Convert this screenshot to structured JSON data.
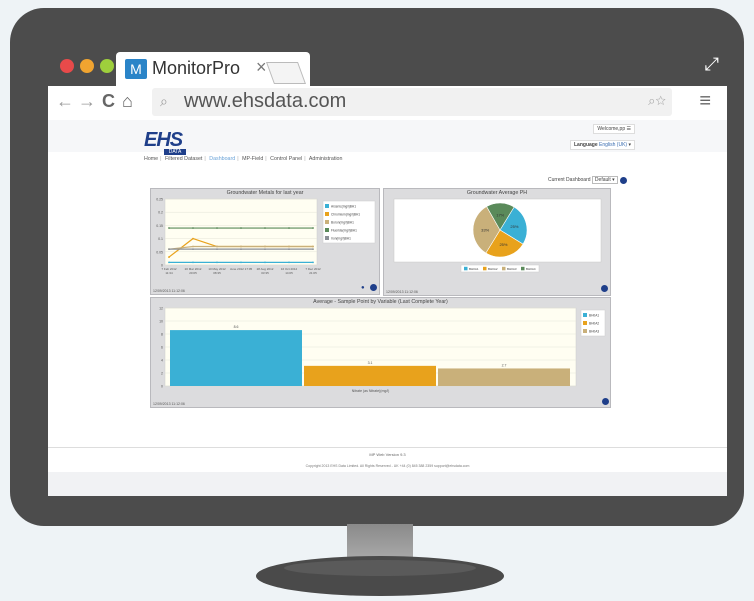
{
  "browser": {
    "tab_title": "MonitorPro",
    "tab_close": "×",
    "url": "www.ehsdata.com"
  },
  "site": {
    "logo": "EHS",
    "logo_sub": "DATA",
    "welcome": "Welcome,pp",
    "language_label": "Language",
    "language_value": "English (UK)"
  },
  "breadcrumb": [
    "Home",
    "Filtered Dataset",
    "Dashboard",
    "MP-Field",
    "Control Panel",
    "Administration"
  ],
  "dashboard": {
    "label": "Current Dashboard",
    "value": "Default"
  },
  "panels": {
    "metals_title": "Groundwater Metals for last year",
    "ph_title": "Groundwater Average PH",
    "avg_title": "Average - Sample Point by Variable (Last Complete Year)",
    "metals_footer": "12/09/2013 11:12:06",
    "ph_footer": "12/09/2013 11:12:06",
    "avg_footer": "12/09/2013 11:12:06"
  },
  "chart_data": [
    {
      "type": "line",
      "title": "Groundwater Metals for last year",
      "y_ticks": [
        "0.25",
        "0.2",
        "0.15",
        "0.1",
        "0.05",
        "0"
      ],
      "ylim": [
        0,
        0.25
      ],
      "x": [
        "7 Feb 2012 11:34",
        "20 Mar 2012 20:05",
        "10 May 2012 08:35",
        "June 2012 17:05",
        "28 Aug 2012 03:35",
        "16 Oct 2012 14:05",
        "7 Dec 2012 21:05"
      ],
      "series": [
        {
          "name": "Arsenic(mg/l)BH1",
          "color": "#3ab0d5",
          "values": [
            0.01,
            0.01,
            0.01,
            0.01,
            0.01,
            0.01,
            0.01
          ]
        },
        {
          "name": "Chromium(mg/l)BH1",
          "color": "#e8a21c",
          "values": [
            0.03,
            0.1,
            0.07,
            0.07,
            0.07,
            0.07,
            0.07
          ]
        },
        {
          "name": "Boron(mg/l)BH1",
          "color": "#c9b07a",
          "values": [
            0.06,
            0.07,
            0.07,
            0.07,
            0.07,
            0.07,
            0.07
          ]
        },
        {
          "name": "Fluoride(mg/l)BH1",
          "color": "#5a8a5a",
          "values": [
            0.14,
            0.14,
            0.14,
            0.14,
            0.14,
            0.14,
            0.14
          ]
        },
        {
          "name": "Iron(mg/l)BH1",
          "color": "#8a8f96",
          "values": [
            0.06,
            0.06,
            0.06,
            0.06,
            0.06,
            0.06,
            0.06
          ]
        }
      ],
      "grid": true,
      "legend": "right"
    },
    {
      "type": "pie",
      "title": "Groundwater Average PH",
      "slices": [
        {
          "name": "BH0A1",
          "value": 25,
          "color": "#3ab0d5",
          "label": "25%"
        },
        {
          "name": "BH0A2",
          "value": 25,
          "color": "#e8a21c",
          "label": "25%"
        },
        {
          "name": "BH0A3",
          "value": 33,
          "color": "#c9b07a",
          "label": "33%"
        },
        {
          "name": "BH0A4",
          "value": 17,
          "color": "#5a8a5a",
          "label": "17%"
        }
      ],
      "legend": "bottom"
    },
    {
      "type": "bar",
      "title": "Average - Sample Point by Variable (Last Complete Year)",
      "categories": [
        "Nitrate (as Nitrate)(mg/l)"
      ],
      "series": [
        {
          "name": "BH0A1",
          "color": "#3ab0d5",
          "values": [
            8.6
          ]
        },
        {
          "name": "BH0A2",
          "color": "#e8a21c",
          "values": [
            3.1
          ]
        },
        {
          "name": "BH0A3",
          "color": "#c9b07a",
          "values": [
            2.7
          ]
        }
      ],
      "y_ticks": [
        "12",
        "10",
        "8",
        "6",
        "4",
        "2",
        "0"
      ],
      "ylim": [
        0,
        12
      ],
      "legend": "top-right"
    }
  ],
  "footer": {
    "version": "MP Web Version 9.3",
    "copyright": "Copyright 2013 EHS Data Limited. All Rights Reserved - UK +44 (0) 845 388 2359 support@ehsdata.com"
  }
}
